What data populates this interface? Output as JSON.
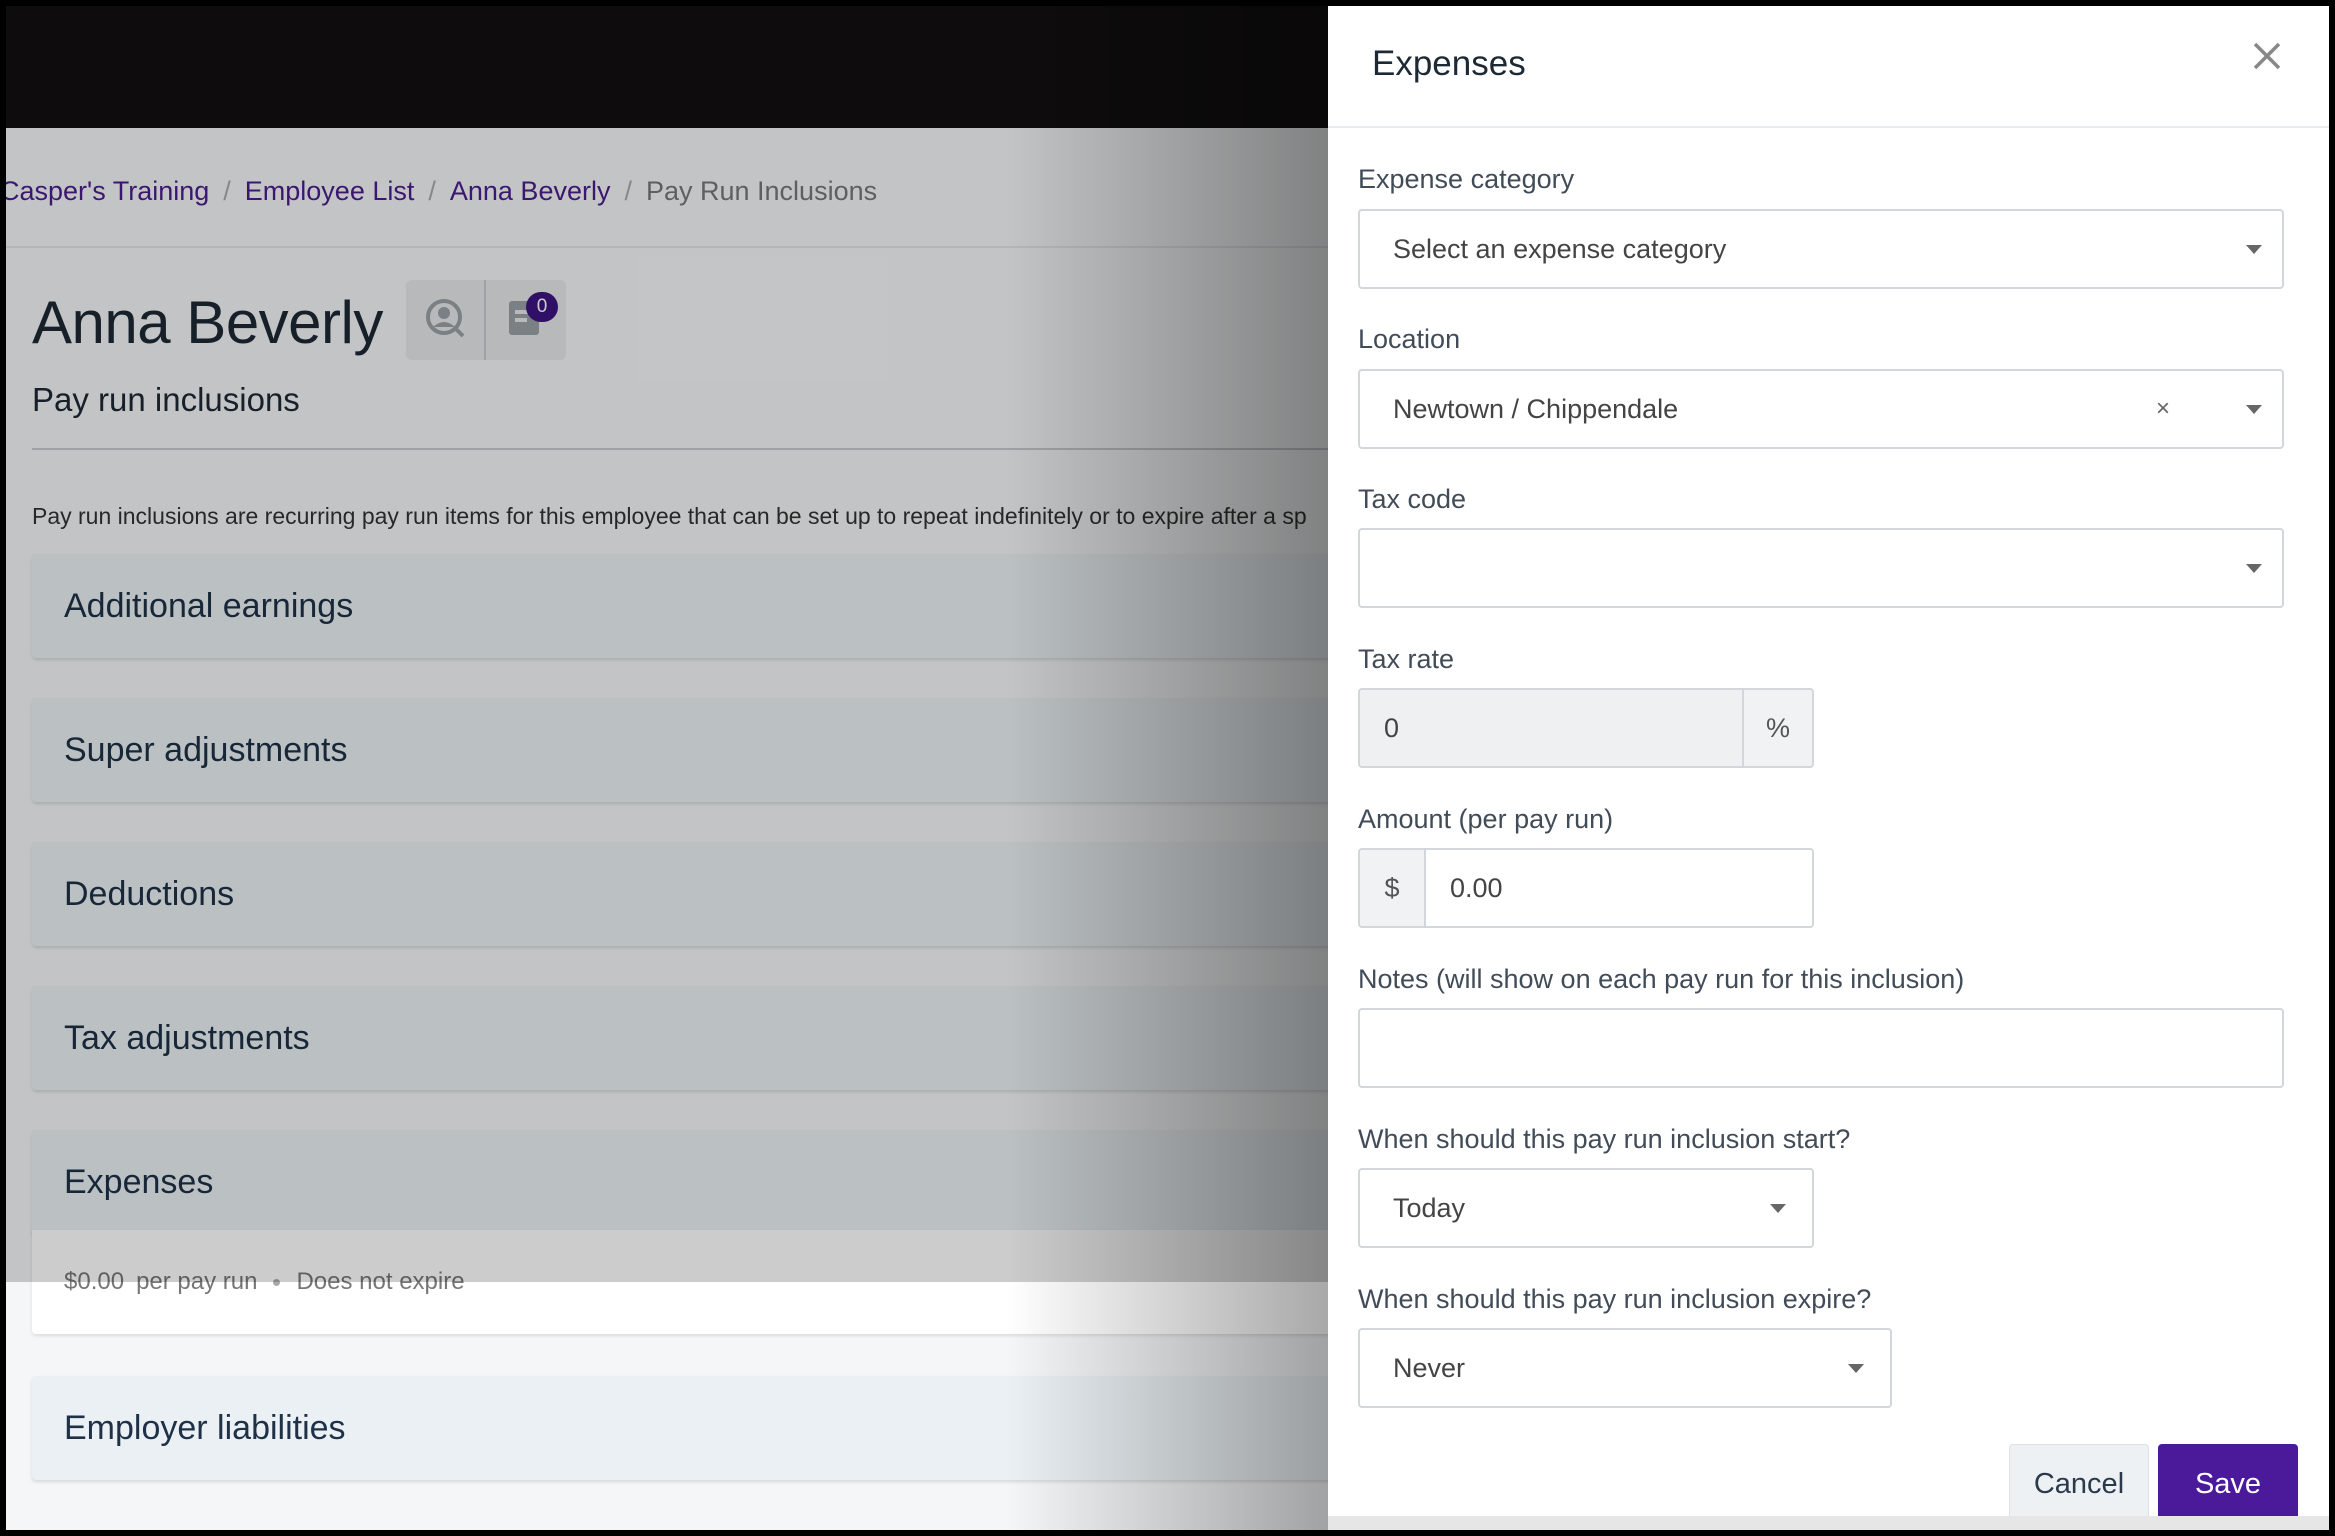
{
  "breadcrumb": {
    "items": [
      "Casper's Training",
      "Employee List",
      "Anna Beverly"
    ],
    "current": "Pay Run Inclusions"
  },
  "employee": {
    "name": "Anna Beverly",
    "notes_count": "0",
    "page_subtitle": "Pay run inclusions",
    "intro_text": "Pay run inclusions are recurring pay run items for this employee that can be set up to repeat indefinitely or to expire after a sp"
  },
  "sections": [
    {
      "title": "Additional earnings"
    },
    {
      "title": "Super adjustments"
    },
    {
      "title": "Deductions"
    },
    {
      "title": "Tax adjustments"
    },
    {
      "title": "Expenses"
    },
    {
      "title": "Employer liabilities"
    }
  ],
  "expense_item": {
    "amount": "$0.00",
    "frequency": "per pay run",
    "expiry": "Does not expire"
  },
  "panel": {
    "title": "Expenses",
    "expense_category": {
      "label": "Expense category",
      "placeholder": "Select an expense category"
    },
    "location": {
      "label": "Location",
      "value": "Newtown / Chippendale",
      "clear": "×"
    },
    "tax_code": {
      "label": "Tax code",
      "value": ""
    },
    "tax_rate": {
      "label": "Tax rate",
      "value": "0",
      "suffix": "%"
    },
    "amount": {
      "label": "Amount (per pay run)",
      "prefix": "$",
      "value": "0.00"
    },
    "notes": {
      "label": "Notes (will show on each pay run for this inclusion)",
      "value": ""
    },
    "start": {
      "label": "When should this pay run inclusion start?",
      "value": "Today"
    },
    "expire": {
      "label": "When should this pay run inclusion expire?",
      "value": "Never"
    },
    "cancel_label": "Cancel",
    "save_label": "Save"
  },
  "colors": {
    "brand_purple": "#4a1a9a",
    "link_purple": "#4b1d8c",
    "topbar": "#120f10"
  }
}
